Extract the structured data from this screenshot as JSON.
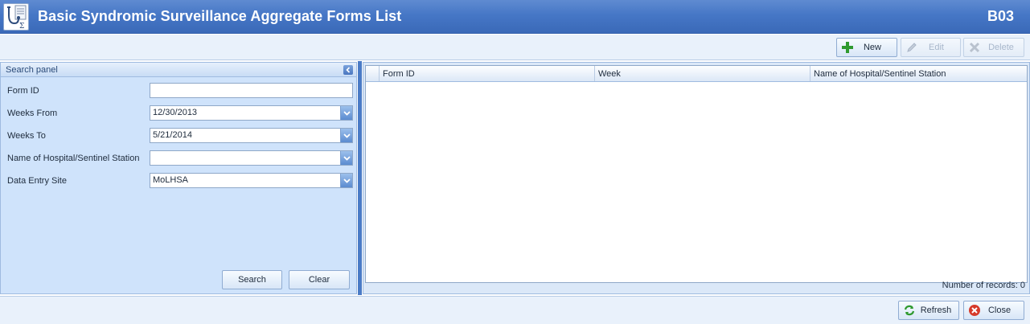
{
  "header": {
    "title": "Basic Syndromic Surveillance Aggregate Forms List",
    "code": "B03",
    "icon": "stethoscope-sigma-icon"
  },
  "toolbar": {
    "new_label": "New",
    "edit_label": "Edit",
    "delete_label": "Delete"
  },
  "search_panel": {
    "title": "Search panel",
    "fields": {
      "form_id": {
        "label": "Form ID",
        "value": ""
      },
      "weeks_from": {
        "label": "Weeks From",
        "value": "12/30/2013"
      },
      "weeks_to": {
        "label": "Weeks To",
        "value": "5/21/2014"
      },
      "hospital": {
        "label": "Name of Hospital/Sentinel Station",
        "value": ""
      },
      "site": {
        "label": "Data Entry Site",
        "value": "MoLHSA"
      }
    },
    "search_label": "Search",
    "clear_label": "Clear"
  },
  "grid": {
    "columns": [
      "Form ID",
      "Week",
      "Name of Hospital/Sentinel Station"
    ],
    "rows": [],
    "records_text": "Number of records: 0"
  },
  "footer": {
    "refresh_label": "Refresh",
    "close_label": "Close"
  },
  "colors": {
    "titlebar": "#4677c6",
    "panel": "#cfe3fb",
    "splitter": "#4a7bc6"
  }
}
